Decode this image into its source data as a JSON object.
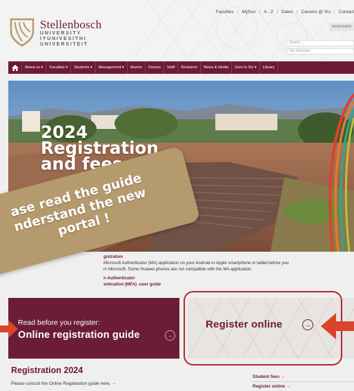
{
  "header": {
    "brand_main": "Stellenbosch",
    "brand_lines": [
      "UNIVERSITY",
      "IYUNIVESITHI",
      "UNIVERSITEIT"
    ],
    "top_links": [
      "Faculties",
      "MySun",
      "A - Z",
      "Dates",
      "Careers @ SU",
      "Contact"
    ],
    "language_button": "AFRIKAANS",
    "search_placeholder": "Search...",
    "top_searches_label": "Top Searches"
  },
  "nav": {
    "items": [
      "About us",
      "Faculties",
      "Students",
      "Management",
      "Alumni",
      "Donors",
      "Staff",
      "Research",
      "News & Media",
      "Give to SU",
      "Library"
    ],
    "dropdown_items": [
      "About us",
      "Faculties",
      "Students",
      "Management",
      "Give to SU"
    ]
  },
  "hero": {
    "title_lines": [
      "2024",
      "Registration",
      "and fees"
    ]
  },
  "banner": {
    "lines": [
      "ase read the guide",
      "nderstand the new",
      "portal !"
    ]
  },
  "info": {
    "heading": "gistration",
    "text1": "Microsoft Authenticator (MA) application on your Android or Apple smartphone or tablet before you",
    "text2": "m Microsoft. Some Huawei phones are not compatible with the MA application.",
    "link1": "n Authenticator",
    "link2": "entication (MFA) -user guide"
  },
  "cards": {
    "left_line1": "Read before you register:",
    "left_line2": "Online registration guide",
    "right_label": "Register online"
  },
  "section": {
    "title": "Registration 2024",
    "text": "Please consult the Online Registration guide here. →"
  },
  "side_links": [
    "Student fees →",
    "Register online →"
  ],
  "colors": {
    "maroon": "#6d1a34",
    "gold": "#b49a6c",
    "red_arrow": "#d9442a"
  }
}
